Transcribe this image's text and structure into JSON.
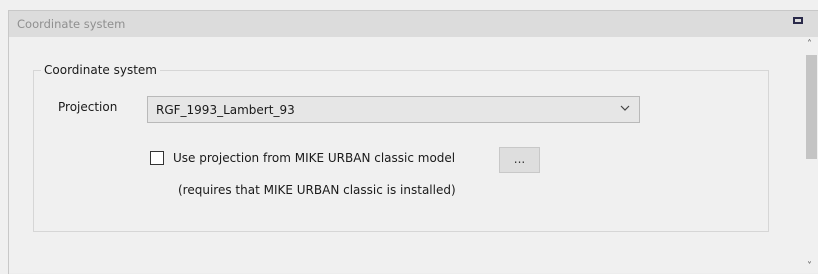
{
  "window": {
    "title": "Coordinate system",
    "restore_icon": "restore-icon",
    "close_glyph": "×"
  },
  "group": {
    "legend": "Coordinate system",
    "projection_label": "Projection",
    "projection_value": "RGF_1993_Lambert_93",
    "use_classic_checked": false,
    "use_classic_label": "Use projection from MIKE URBAN classic model",
    "browse_label": "...",
    "requires_note": "(requires that MIKE URBAN classic is installed)"
  },
  "scrollbar": {
    "up_glyph": "˄",
    "down_glyph": "˅"
  }
}
